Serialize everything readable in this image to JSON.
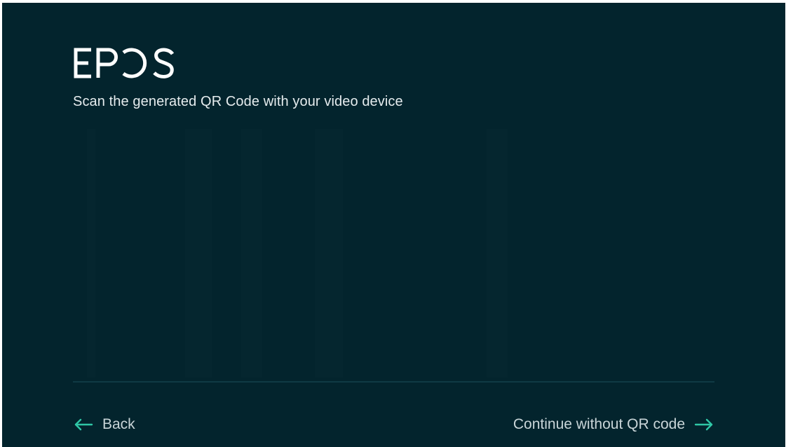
{
  "brand": {
    "logo_text": "EPOS",
    "logo_icon": "epos-logo"
  },
  "header": {
    "subtitle": "Scan the generated QR Code with your video device"
  },
  "footer": {
    "back_label": "Back",
    "back_icon": "arrow-left-icon",
    "continue_label": "Continue without QR code",
    "continue_icon": "arrow-right-icon"
  },
  "colors": {
    "background": "#03242d",
    "text": "#e6ecee",
    "accent": "#2fc7a6",
    "divider": "#0f3a44"
  }
}
